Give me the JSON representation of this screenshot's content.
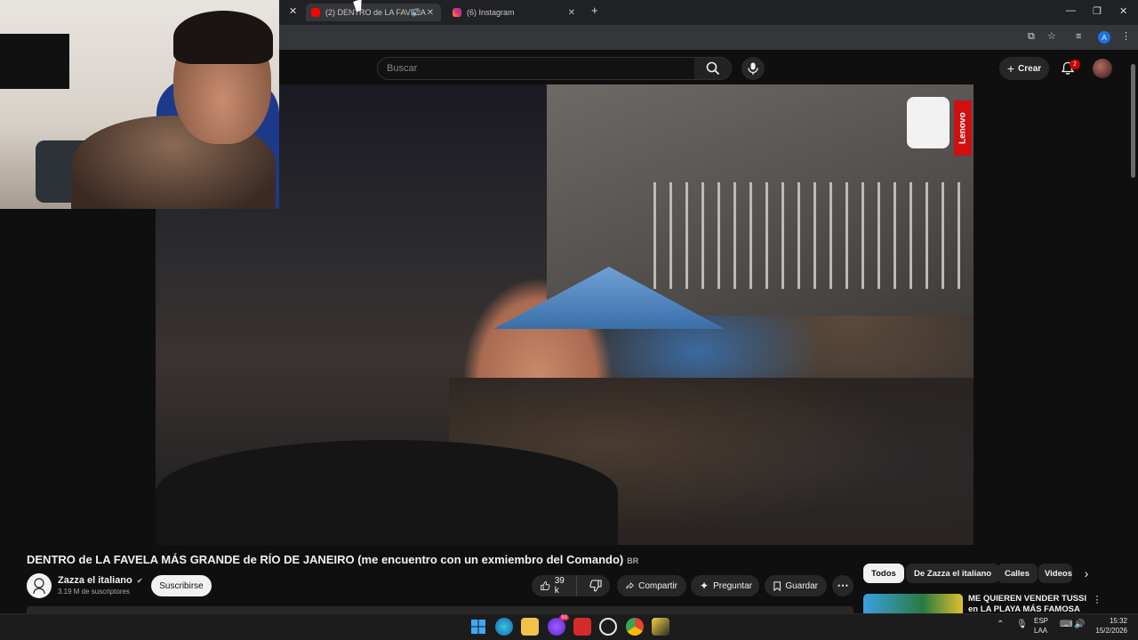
{
  "browser": {
    "tabs": [
      {
        "label": "(2) DENTRO de LA FAVELA",
        "favicon": "youtube-icon",
        "active": true
      },
      {
        "label": "(6) Instagram",
        "favicon": "instagram-icon",
        "active": false
      }
    ]
  },
  "youtube": {
    "search_placeholder": "Buscar",
    "create_label": "Crear",
    "notification_count": "2"
  },
  "video": {
    "brand_watermark": "Lenovo"
  },
  "meta": {
    "title": "DENTRO de LA FAVELA MÁS GRANDE de RÍO DE JANEIRO (me encuentro con un exmiembro del Comando)",
    "title_badge": "BR",
    "channel_name": "Zazza el italiano",
    "subscribers": "3.19 M de suscriptores",
    "subscribe_label": "Suscribirse",
    "like_count": "39 k",
    "share_label": "Compartir",
    "ask_label": "Preguntar",
    "save_label": "Guardar"
  },
  "sidebar": {
    "chips": [
      "Todos",
      "De Zazza el italiano",
      "Calles",
      "Videos"
    ],
    "recommendation_title": "ME QUIEREN VENDER TUSSI en LA PLAYA MÁS FAMOSA DEL"
  },
  "taskbar": {
    "lang_1": "ESP",
    "lang_2": "LAA",
    "time": "15:32",
    "date": "15/2/2026",
    "messenger_badge": "93"
  },
  "colors": {
    "youtube_red": "#ff0000",
    "lenovo_red": "#d01010",
    "notification_red": "#cc0000",
    "page_bg": "#0f0f0f"
  }
}
